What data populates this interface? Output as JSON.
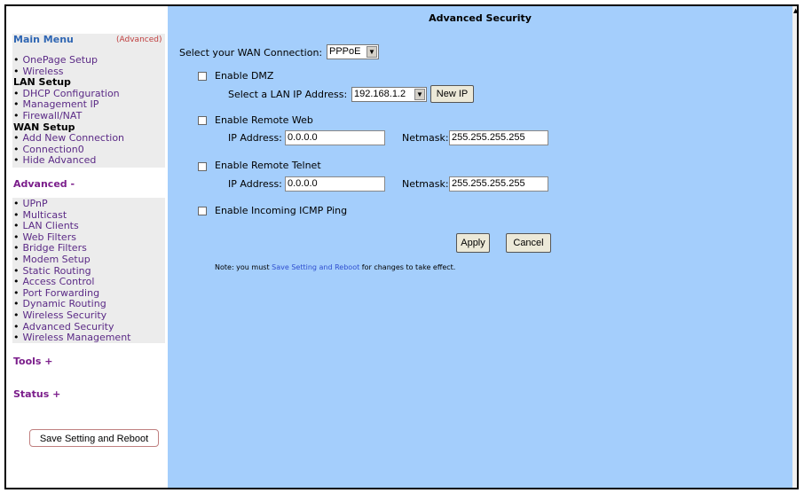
{
  "sidebar": {
    "main_menu_title": "Main Menu",
    "advanced_hint": "(Advanced)",
    "main_items": [
      {
        "label": "OnePage Setup",
        "type": "link"
      },
      {
        "label": "Wireless",
        "type": "link"
      },
      {
        "label": "LAN Setup",
        "type": "section"
      },
      {
        "label": "DHCP Configuration",
        "type": "link"
      },
      {
        "label": "Management IP",
        "type": "link"
      },
      {
        "label": "Firewall/NAT",
        "type": "link"
      },
      {
        "label": "WAN Setup",
        "type": "section"
      },
      {
        "label": "Add New Connection",
        "type": "link"
      },
      {
        "label": "Connection0",
        "type": "link"
      },
      {
        "label": "Hide Advanced",
        "type": "link"
      }
    ],
    "advanced_title": "Advanced -",
    "advanced_items": [
      "UPnP",
      "Multicast",
      "LAN Clients",
      "Web Filters",
      "Bridge Filters",
      "Modem Setup",
      "Static Routing",
      "Access Control",
      "Port Forwarding",
      "Dynamic Routing",
      "Wireless Security",
      "Advanced Security",
      "Wireless Management"
    ],
    "tools_title": "Tools +",
    "status_title": "Status +",
    "save_button": "Save Setting and Reboot"
  },
  "main": {
    "title": "Advanced Security",
    "wan_label": "Select your WAN Connection:",
    "wan_value": "PPPoE",
    "dmz": {
      "checkbox_label": "Enable DMZ",
      "lan_ip_label": "Select a LAN IP Address:",
      "lan_ip_value": "192.168.1.2",
      "new_ip_button": "New IP"
    },
    "remote_web": {
      "checkbox_label": "Enable Remote Web",
      "ip_label": "IP Address:",
      "ip_value": "0.0.0.0",
      "netmask_label": "Netmask:",
      "netmask_value": "255.255.255.255"
    },
    "remote_telnet": {
      "checkbox_label": "Enable Remote Telnet",
      "ip_label": "IP Address:",
      "ip_value": "0.0.0.0",
      "netmask_label": "Netmask:",
      "netmask_value": "255.255.255.255"
    },
    "icmp": {
      "checkbox_label": "Enable Incoming ICMP Ping"
    },
    "apply_button": "Apply",
    "cancel_button": "Cancel",
    "note_prefix": "Note: you must",
    "note_link": "Save Setting and Reboot",
    "note_suffix": "for changes to take effect."
  },
  "colors": {
    "main_background": "#a4cefc",
    "menu_title": "#2f66b3",
    "section_title": "#7b1e8b",
    "link": "#5b2a86"
  }
}
